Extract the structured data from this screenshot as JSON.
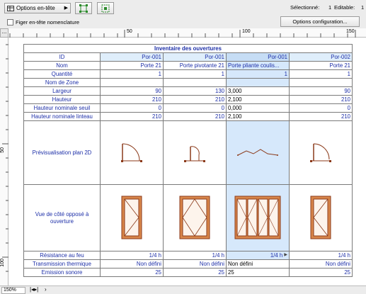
{
  "toolbar": {
    "options_label": "Options en-tête",
    "select_label": "Sélectionné:",
    "select_value": "1",
    "edit_label": "Editable:",
    "edit_value": "1"
  },
  "toolbar2": {
    "freeze_label": "Figer en-tête nomenclature",
    "config_label": "Options configuration..."
  },
  "rulers": {
    "h_ticks": [
      "50",
      "100",
      "150"
    ],
    "v_ticks": [
      "50",
      "100"
    ]
  },
  "status": {
    "zoom": "150%"
  },
  "schedule": {
    "title": "Inventaire des ouvertures",
    "columns": [
      {
        "id": "Por-001",
        "nom": "Porte 21",
        "qte": "1",
        "zone": "",
        "largeur": "90",
        "hauteur": "210",
        "seuil": "0",
        "linteau": "210",
        "feu": "1/4 h",
        "therm": "Non défini",
        "sono": "25"
      },
      {
        "id": "Por-001",
        "nom": "Porte pivotante 21",
        "qte": "1",
        "zone": "",
        "largeur": "130",
        "hauteur": "210",
        "seuil": "0",
        "linteau": "210",
        "feu": "1/4 h",
        "therm": "Non défini",
        "sono": "25"
      },
      {
        "id": "Por-001",
        "nom": "Porte pliante coulis...",
        "qte": "1",
        "zone": "",
        "largeur": "3,000",
        "hauteur": "2,100",
        "seuil": "0,000",
        "linteau": "2,100",
        "feu": "1/4 h",
        "therm": "Non défini",
        "sono": "25"
      },
      {
        "id": "Por-002",
        "nom": "Porte 21",
        "qte": "1",
        "zone": "",
        "largeur": "90",
        "hauteur": "210",
        "seuil": "0",
        "linteau": "210",
        "feu": "1/4 h",
        "therm": "Non défini",
        "sono": "25"
      }
    ],
    "row_labels": {
      "id": "ID",
      "nom": "Nom",
      "qte": "Quantité",
      "zone": "Nom de Zone",
      "largeur": "Largeur",
      "hauteur": "Hauteur",
      "seuil": "Hauteur nominale seuil",
      "linteau": "Hauteur nominale linteau",
      "plan": "Prévisualisation plan 2D",
      "vue": "Vue de côté opposé à ouverture",
      "feu": "Résistance au feu",
      "therm": "Transmission thermique",
      "sono": "Emission sonore"
    }
  },
  "colors": {
    "label_blue": "#1d2fa8",
    "selected_column": "#d6e8fb",
    "door_brown": "#a0522d"
  }
}
